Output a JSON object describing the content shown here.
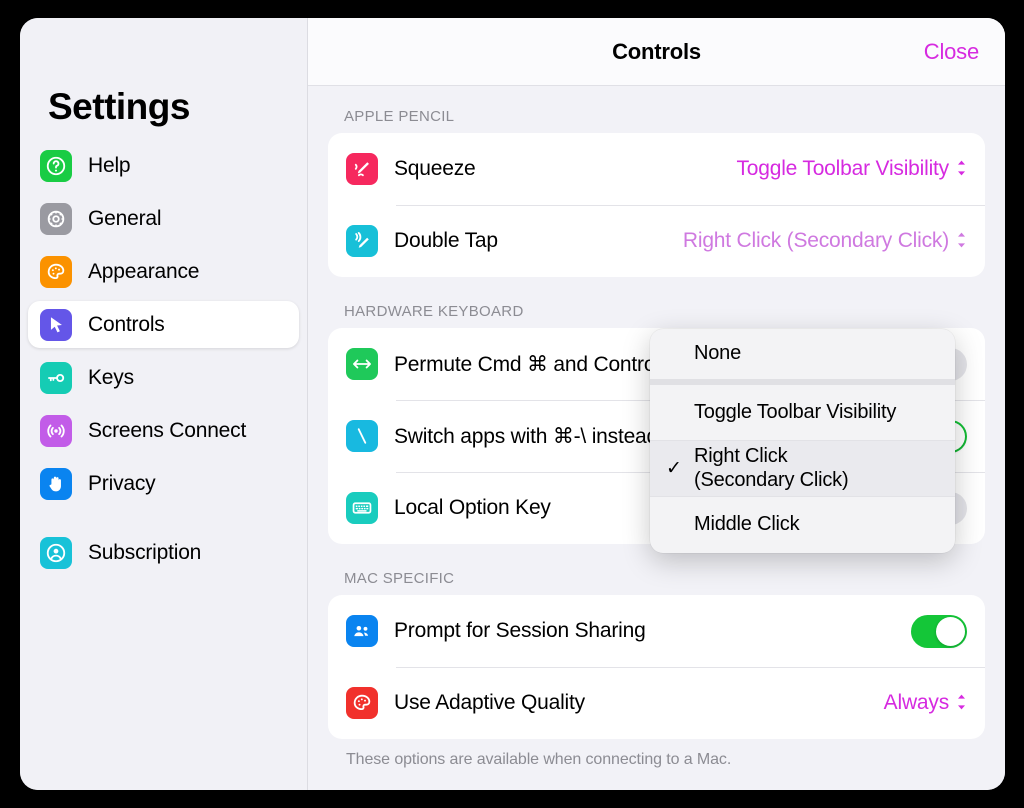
{
  "window": {
    "title": "Controls"
  },
  "sidebar": {
    "title": "Settings",
    "items": [
      {
        "label": "Help",
        "icon": "question-mark-icon",
        "color": "#19cc44"
      },
      {
        "label": "General",
        "icon": "gear-icon",
        "color": "#9a9aa1"
      },
      {
        "label": "Appearance",
        "icon": "palette-icon",
        "color": "#fb9200"
      },
      {
        "label": "Controls",
        "icon": "cursor-arrow-icon",
        "color": "#6456e8",
        "selected": true
      },
      {
        "label": "Keys",
        "icon": "key-icon",
        "color": "#15ccb4"
      },
      {
        "label": "Screens Connect",
        "icon": "broadcast-icon",
        "color": "#c25ce8"
      },
      {
        "label": "Privacy",
        "icon": "hand-raised-icon",
        "color": "#0a84f0"
      },
      {
        "label": "Subscription",
        "icon": "person-circle-icon",
        "color": "#18c2d8",
        "gap_before": true
      }
    ]
  },
  "header": {
    "title": "Controls",
    "close_label": "Close",
    "accent_color": "#d62ae0"
  },
  "sections": [
    {
      "header": "APPLE PENCIL",
      "rows": [
        {
          "label": "Squeeze",
          "icon": "pencil-squeeze-icon",
          "color": "#f6285e",
          "control": "popup",
          "value": "Toggle Toolbar Visibility",
          "dimmed": false
        },
        {
          "label": "Double Tap",
          "icon": "pencil-tap-icon",
          "color": "#17c0d8",
          "control": "popup",
          "value": "Right Click (Secondary Click)",
          "dimmed": true
        }
      ]
    },
    {
      "header": "HARDWARE KEYBOARD",
      "rows": [
        {
          "label": "Permute Cmd ⌘ and Control ⌃ keys",
          "icon": "left-right-arrow-icon",
          "color": "#1fc95a",
          "control": "toggle",
          "on": false
        },
        {
          "label": "Switch apps with ⌘-\\ instead of ⌘-Tab",
          "icon": "backslash-key-icon",
          "color": "#18b9e0",
          "control": "toggle",
          "on": true
        },
        {
          "label": "Local Option Key",
          "icon": "keyboard-icon",
          "color": "#19ccbe",
          "control": "toggle",
          "on": false
        }
      ]
    },
    {
      "header": "MAC SPECIFIC",
      "rows": [
        {
          "label": "Prompt for Session Sharing",
          "icon": "people-icon",
          "color": "#0a84f0",
          "control": "toggle",
          "on": true
        },
        {
          "label": "Use Adaptive Quality",
          "icon": "palette-icon",
          "color": "#f1312c",
          "control": "popup",
          "value": "Always",
          "dimmed": false
        }
      ],
      "footnote": "These options are available when connecting to a Mac."
    }
  ],
  "dropdown": {
    "owner": "Double Tap",
    "items": [
      {
        "label": "None",
        "checked": false
      },
      {
        "label": "Toggle Toolbar Visibility",
        "checked": false
      },
      {
        "label": "Right Click\n(Secondary Click)",
        "checked": true
      },
      {
        "label": "Middle Click",
        "checked": false
      }
    ],
    "checkmark": "✓"
  }
}
